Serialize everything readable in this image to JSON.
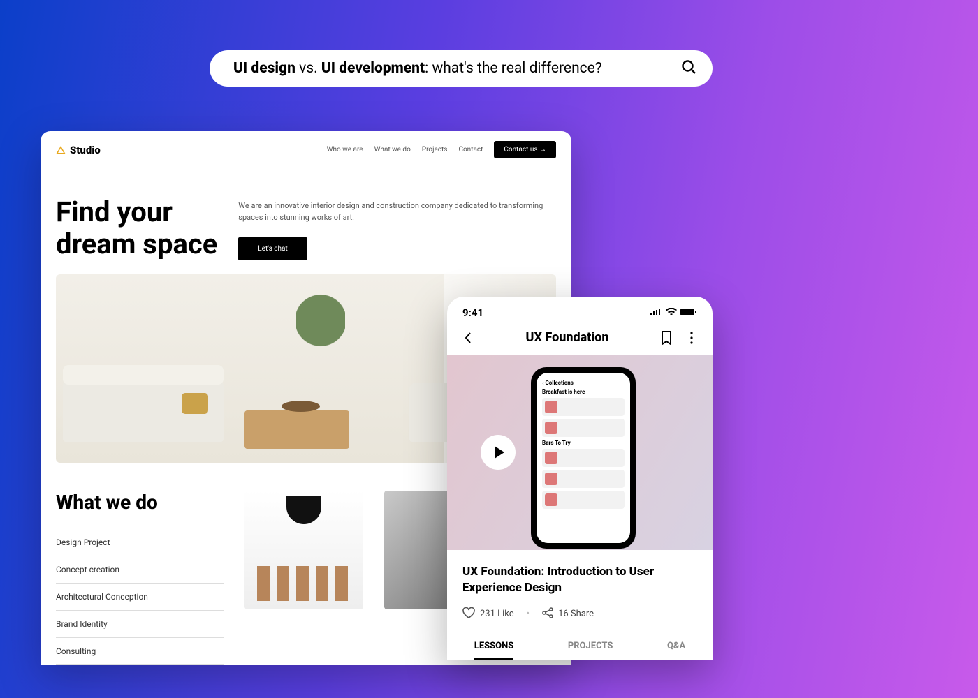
{
  "search": {
    "bold1": "UI design",
    "vs": " vs. ",
    "bold2": "UI development",
    "rest": ": what's the real difference?"
  },
  "desktop": {
    "logo": "Studio",
    "nav": [
      "Who we are",
      "What we do",
      "Projects",
      "Contact"
    ],
    "cta_nav": "Contact us →",
    "hero_line1": "Find your",
    "hero_line2": "dream space",
    "hero_sub": "We are an innovative interior design and construction company dedicated to transforming spaces into stunning works of art.",
    "hero_cta": "Let's chat",
    "section_title": "What we do",
    "services": [
      "Design Project",
      "Concept creation",
      "Architectural Conception",
      "Brand Identity",
      "Consulting"
    ]
  },
  "mobile": {
    "time": "9:41",
    "title": "UX Foundation",
    "inner_back": "Collections",
    "inner_h1": "Breakfast is here",
    "inner_h2": "Bars To Try",
    "course_title": "UX Foundation: Introduction to User Experience Design",
    "likes": "231 Like",
    "shares": "16 Share",
    "tabs": [
      "LESSONS",
      "PROJECTS",
      "Q&A"
    ]
  }
}
